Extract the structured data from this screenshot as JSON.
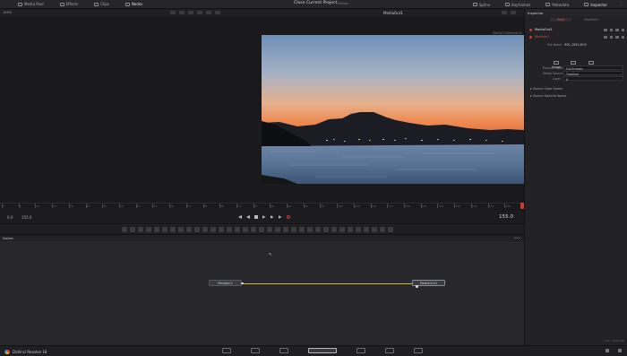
{
  "topbar": {
    "media_pool": "Media Pool",
    "effects": "Effects",
    "clips": "Clips",
    "nodes": "Nodes",
    "project_title": "Close Current Project",
    "edited": "Edited",
    "spline": "Spline",
    "keyframes": "Keyframes",
    "metadata": "Metadata",
    "inspector": "Inspector"
  },
  "viewer": {
    "zoom": "100%",
    "title": "MediaOut1",
    "resolution": "3840x2160xfloat32"
  },
  "ruler": {
    "labels": [
      "0",
      "5",
      "10",
      "15",
      "20",
      "25",
      "30",
      "35",
      "40",
      "45",
      "50",
      "55",
      "60",
      "65",
      "70",
      "75",
      "80",
      "85",
      "90",
      "95",
      "100",
      "105",
      "110",
      "115",
      "120",
      "125",
      "130",
      "135",
      "140",
      "145",
      "150",
      "155"
    ]
  },
  "transport": {
    "start": "0.0",
    "end": "155.0",
    "current": "155.0"
  },
  "nodes_panel": {
    "label": "Nodes",
    "menu": "•••",
    "node_in": "MediaIn1",
    "node_out": "MediaOut1"
  },
  "inspector": {
    "header": "Inspector",
    "tab_tools": "Tools",
    "tab_modifiers": "Modifiers",
    "media_out": "MediaOut1",
    "media_in": "MediaIn1",
    "file_name_label": "File Name",
    "file_name_value": "IMG_2981.MOV",
    "subtab_image": "Image",
    "subtab_audio": "Audio",
    "subtab_settings": "Settings",
    "process_mode_label": "Process Mode",
    "process_mode_value": "Full Frames",
    "media_source_label": "Media Source",
    "media_source_value": "Timeline",
    "layer_label": "Layer",
    "layer_value": "0",
    "source_color_space": "Source Color Space",
    "source_gamma_space": "Source Gamma Space",
    "footer": "7.2% - 1936 MB"
  },
  "bottombar": {
    "app_name": "DaVinci Resolve 18"
  },
  "colors": {
    "accent": "#d03c3c",
    "connection": "#d6b43a"
  }
}
